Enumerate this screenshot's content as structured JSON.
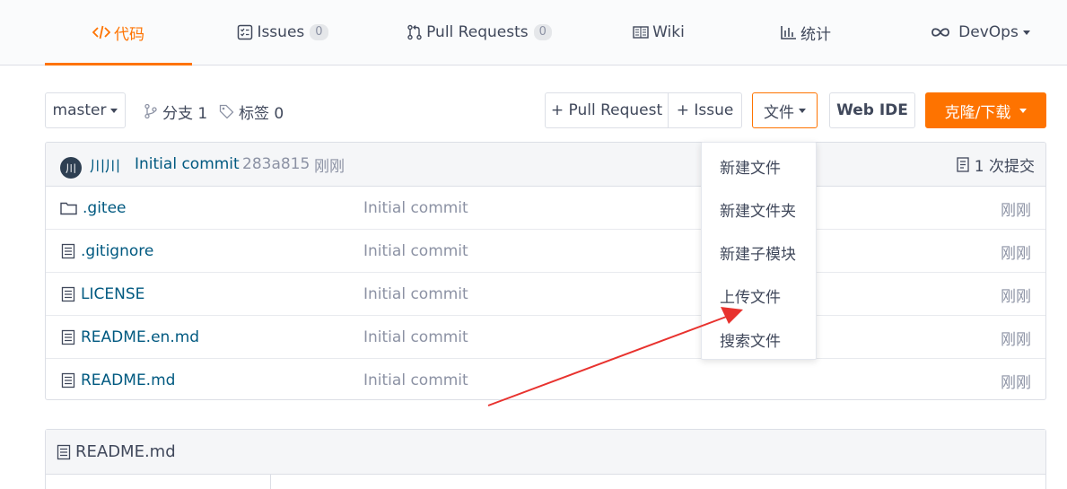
{
  "nav": {
    "tabs": [
      {
        "label": "代码",
        "icon": "code-icon"
      },
      {
        "label": "Issues",
        "icon": "issues-icon",
        "count": "0"
      },
      {
        "label": "Pull Requests",
        "icon": "pull-request-icon",
        "count": "0"
      },
      {
        "label": "Wiki",
        "icon": "wiki-icon"
      },
      {
        "label": "统计",
        "icon": "stats-icon"
      },
      {
        "label": "DevOps",
        "icon": "infinity-icon"
      }
    ]
  },
  "toolbar": {
    "branch": "master",
    "branches": "分支 1",
    "tags": "标签 0",
    "pull_request": "+ Pull Request",
    "issue": "+ Issue",
    "files": "文件",
    "web_ide": "Web IDE",
    "clone": "克隆/下载"
  },
  "commit": {
    "avatar_text": "川",
    "author": "川川",
    "message": "Initial commit",
    "hash": "283a815",
    "time": "刚刚",
    "count": "1 次提交"
  },
  "files": [
    {
      "name": ".gitee",
      "type": "folder",
      "message": "Initial commit",
      "time": "刚刚"
    },
    {
      "name": ".gitignore",
      "type": "file",
      "message": "Initial commit",
      "time": "刚刚"
    },
    {
      "name": "LICENSE",
      "type": "file",
      "message": "Initial commit",
      "time": "刚刚"
    },
    {
      "name": "README.en.md",
      "type": "file",
      "message": "Initial commit",
      "time": "刚刚"
    },
    {
      "name": "README.md",
      "type": "file",
      "message": "Initial commit",
      "time": "刚刚"
    }
  ],
  "file_menu": {
    "items": [
      "新建文件",
      "新建文件夹",
      "新建子模块",
      "上传文件",
      "搜索文件"
    ]
  },
  "readme": {
    "title": "README.md"
  },
  "colors": {
    "accent": "#fe7300",
    "link": "#005980",
    "muted": "#8c92a4",
    "annotation_arrow": "#e8322e"
  }
}
